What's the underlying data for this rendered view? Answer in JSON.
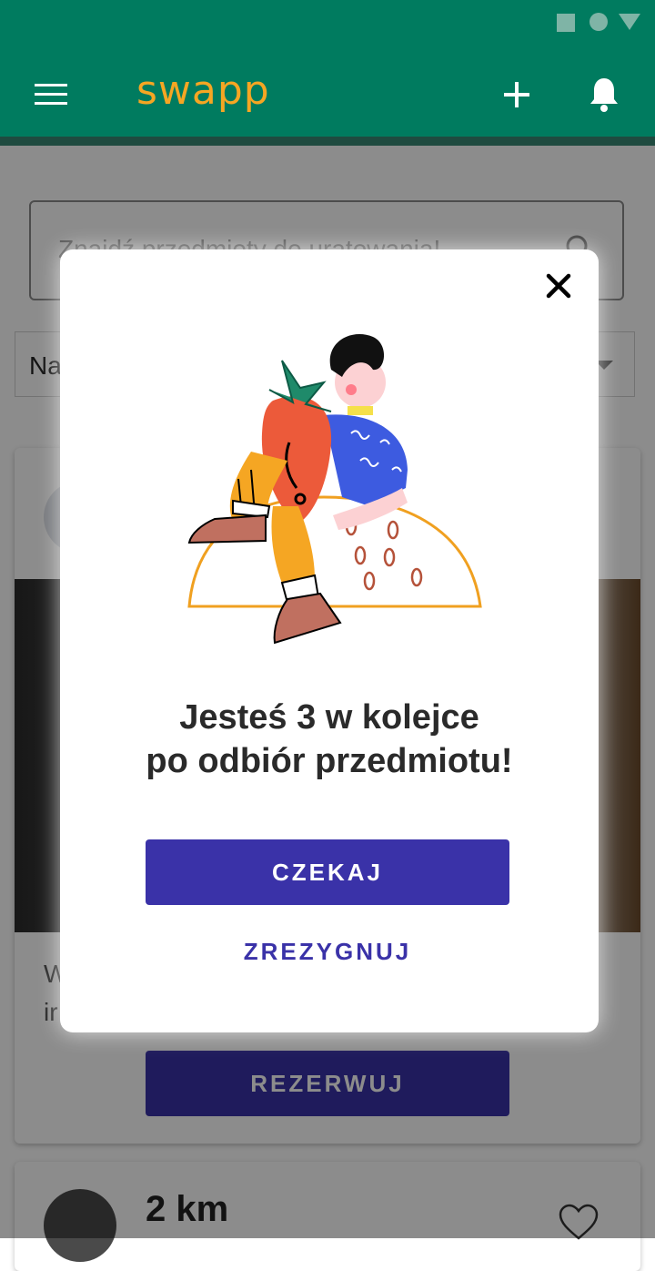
{
  "app": {
    "logo_text": "swapp",
    "icons": [
      "menu-icon",
      "plus-icon",
      "bell-icon"
    ],
    "colors": {
      "appbar": "#007b5f",
      "logo": "#f5a623",
      "accent": "#3a32a8"
    }
  },
  "background": {
    "search": {
      "placeholder": "Znajdź przedmioty do uratowania!"
    },
    "sort_select": {
      "value": "Na"
    },
    "card": {
      "description_line1": "W",
      "description_line2": "ir",
      "reserve_label": "REZERWUJ"
    },
    "card2": {
      "distance": "2 km"
    }
  },
  "dialog": {
    "title_line1": "Jesteś 3 w kolejce",
    "title_line2": "po odbiór przedmiotu!",
    "primary_label": "CZEKAJ",
    "secondary_label": "ZREZYGNUJ",
    "close_icon": "close-icon",
    "illustration_icon": "person-with-strawberry-illustration"
  }
}
